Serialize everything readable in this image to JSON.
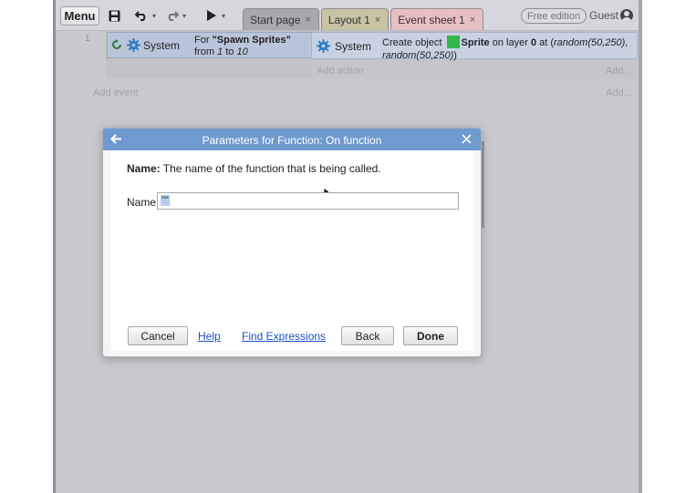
{
  "toolbar": {
    "menu_label": "Menu",
    "tabs": [
      {
        "label": "Start page"
      },
      {
        "label": "Layout 1"
      },
      {
        "label": "Event sheet 1"
      }
    ],
    "tab_close": "×",
    "edition_badge": "Free edition",
    "user_label": "Guest"
  },
  "event_sheet": {
    "event_number": "1",
    "condition": {
      "object": "System",
      "text_prefix": "For ",
      "loop_name": "\"Spawn Sprites\"",
      "text_line2_from": "from ",
      "from": "1",
      "text_to": " to ",
      "to": "10"
    },
    "action": {
      "object": "System",
      "text_create": "Create object",
      "sprite_name": "Sprite",
      "text_on_layer": " on layer ",
      "layer": "0",
      "text_at": " at (",
      "x_expr": "random(50,250)",
      "sep": ",",
      "y_expr": "random(50,250)",
      "close": ")"
    },
    "add_action_label": "Add action",
    "add_right_label": "Add...",
    "add_event_label": "Add event",
    "add_right_label_2": "Add..."
  },
  "dialog": {
    "title": "Parameters for Function: On function",
    "description_label": "Name:",
    "description_text": " The name of the function that is being called.",
    "field_label": "Name",
    "field_value": "\"\"",
    "buttons": {
      "cancel": "Cancel",
      "help": "Help",
      "find_expressions": "Find Expressions",
      "back": "Back",
      "done": "Done"
    }
  },
  "colors": {
    "title_bar": "#6f9ad0",
    "sprite_swatch": "#33b54a",
    "condition_bg": "#b9c5da",
    "link": "#1a4fc8"
  },
  "icons": [
    "save-icon",
    "undo-icon",
    "redo-icon",
    "play-icon",
    "user-icon",
    "loop-icon",
    "gear-icon",
    "back-arrow-icon",
    "close-icon"
  ]
}
